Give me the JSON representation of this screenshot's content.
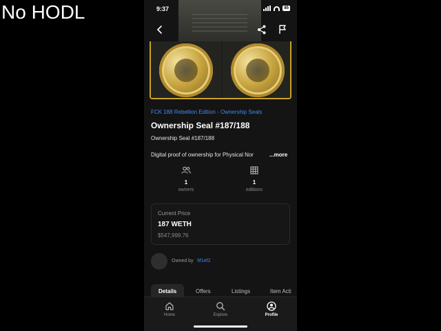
{
  "overlay": {
    "caption": "No HODL"
  },
  "status_bar": {
    "time": "9:37",
    "battery": "85"
  },
  "hero": {
    "header_icons": [
      "back-icon",
      "share-icon",
      "flag-icon"
    ]
  },
  "nft": {
    "collection": "FCK 188 Rebellion Edition - Ownership Seals",
    "title": "Ownership Seal #187/188",
    "subtitle": "Ownership Seal #187/188",
    "description": "Digital proof of ownership for Physical Nor",
    "more_label": "...more"
  },
  "stats": {
    "owners": {
      "value": "1",
      "label": "owners",
      "icon": "owners-icon"
    },
    "editions": {
      "value": "1",
      "label": "editions",
      "icon": "editions-grid-icon"
    }
  },
  "price": {
    "label": "Current Price",
    "value": "187 WETH",
    "usd": "$547,999.76"
  },
  "owner": {
    "prefix": "Owned by",
    "name": "9f1ef2"
  },
  "tabs": [
    "Details",
    "Offers",
    "Listings",
    "Item Acti"
  ],
  "bottom_nav": [
    {
      "label": "Home",
      "icon": "home-icon"
    },
    {
      "label": "Explore",
      "icon": "search-icon"
    },
    {
      "label": "Profile",
      "icon": "profile-icon",
      "active": true
    }
  ],
  "colors": {
    "accent": "#3b8cf0",
    "frame": "#c9a227",
    "background": "#141414"
  }
}
